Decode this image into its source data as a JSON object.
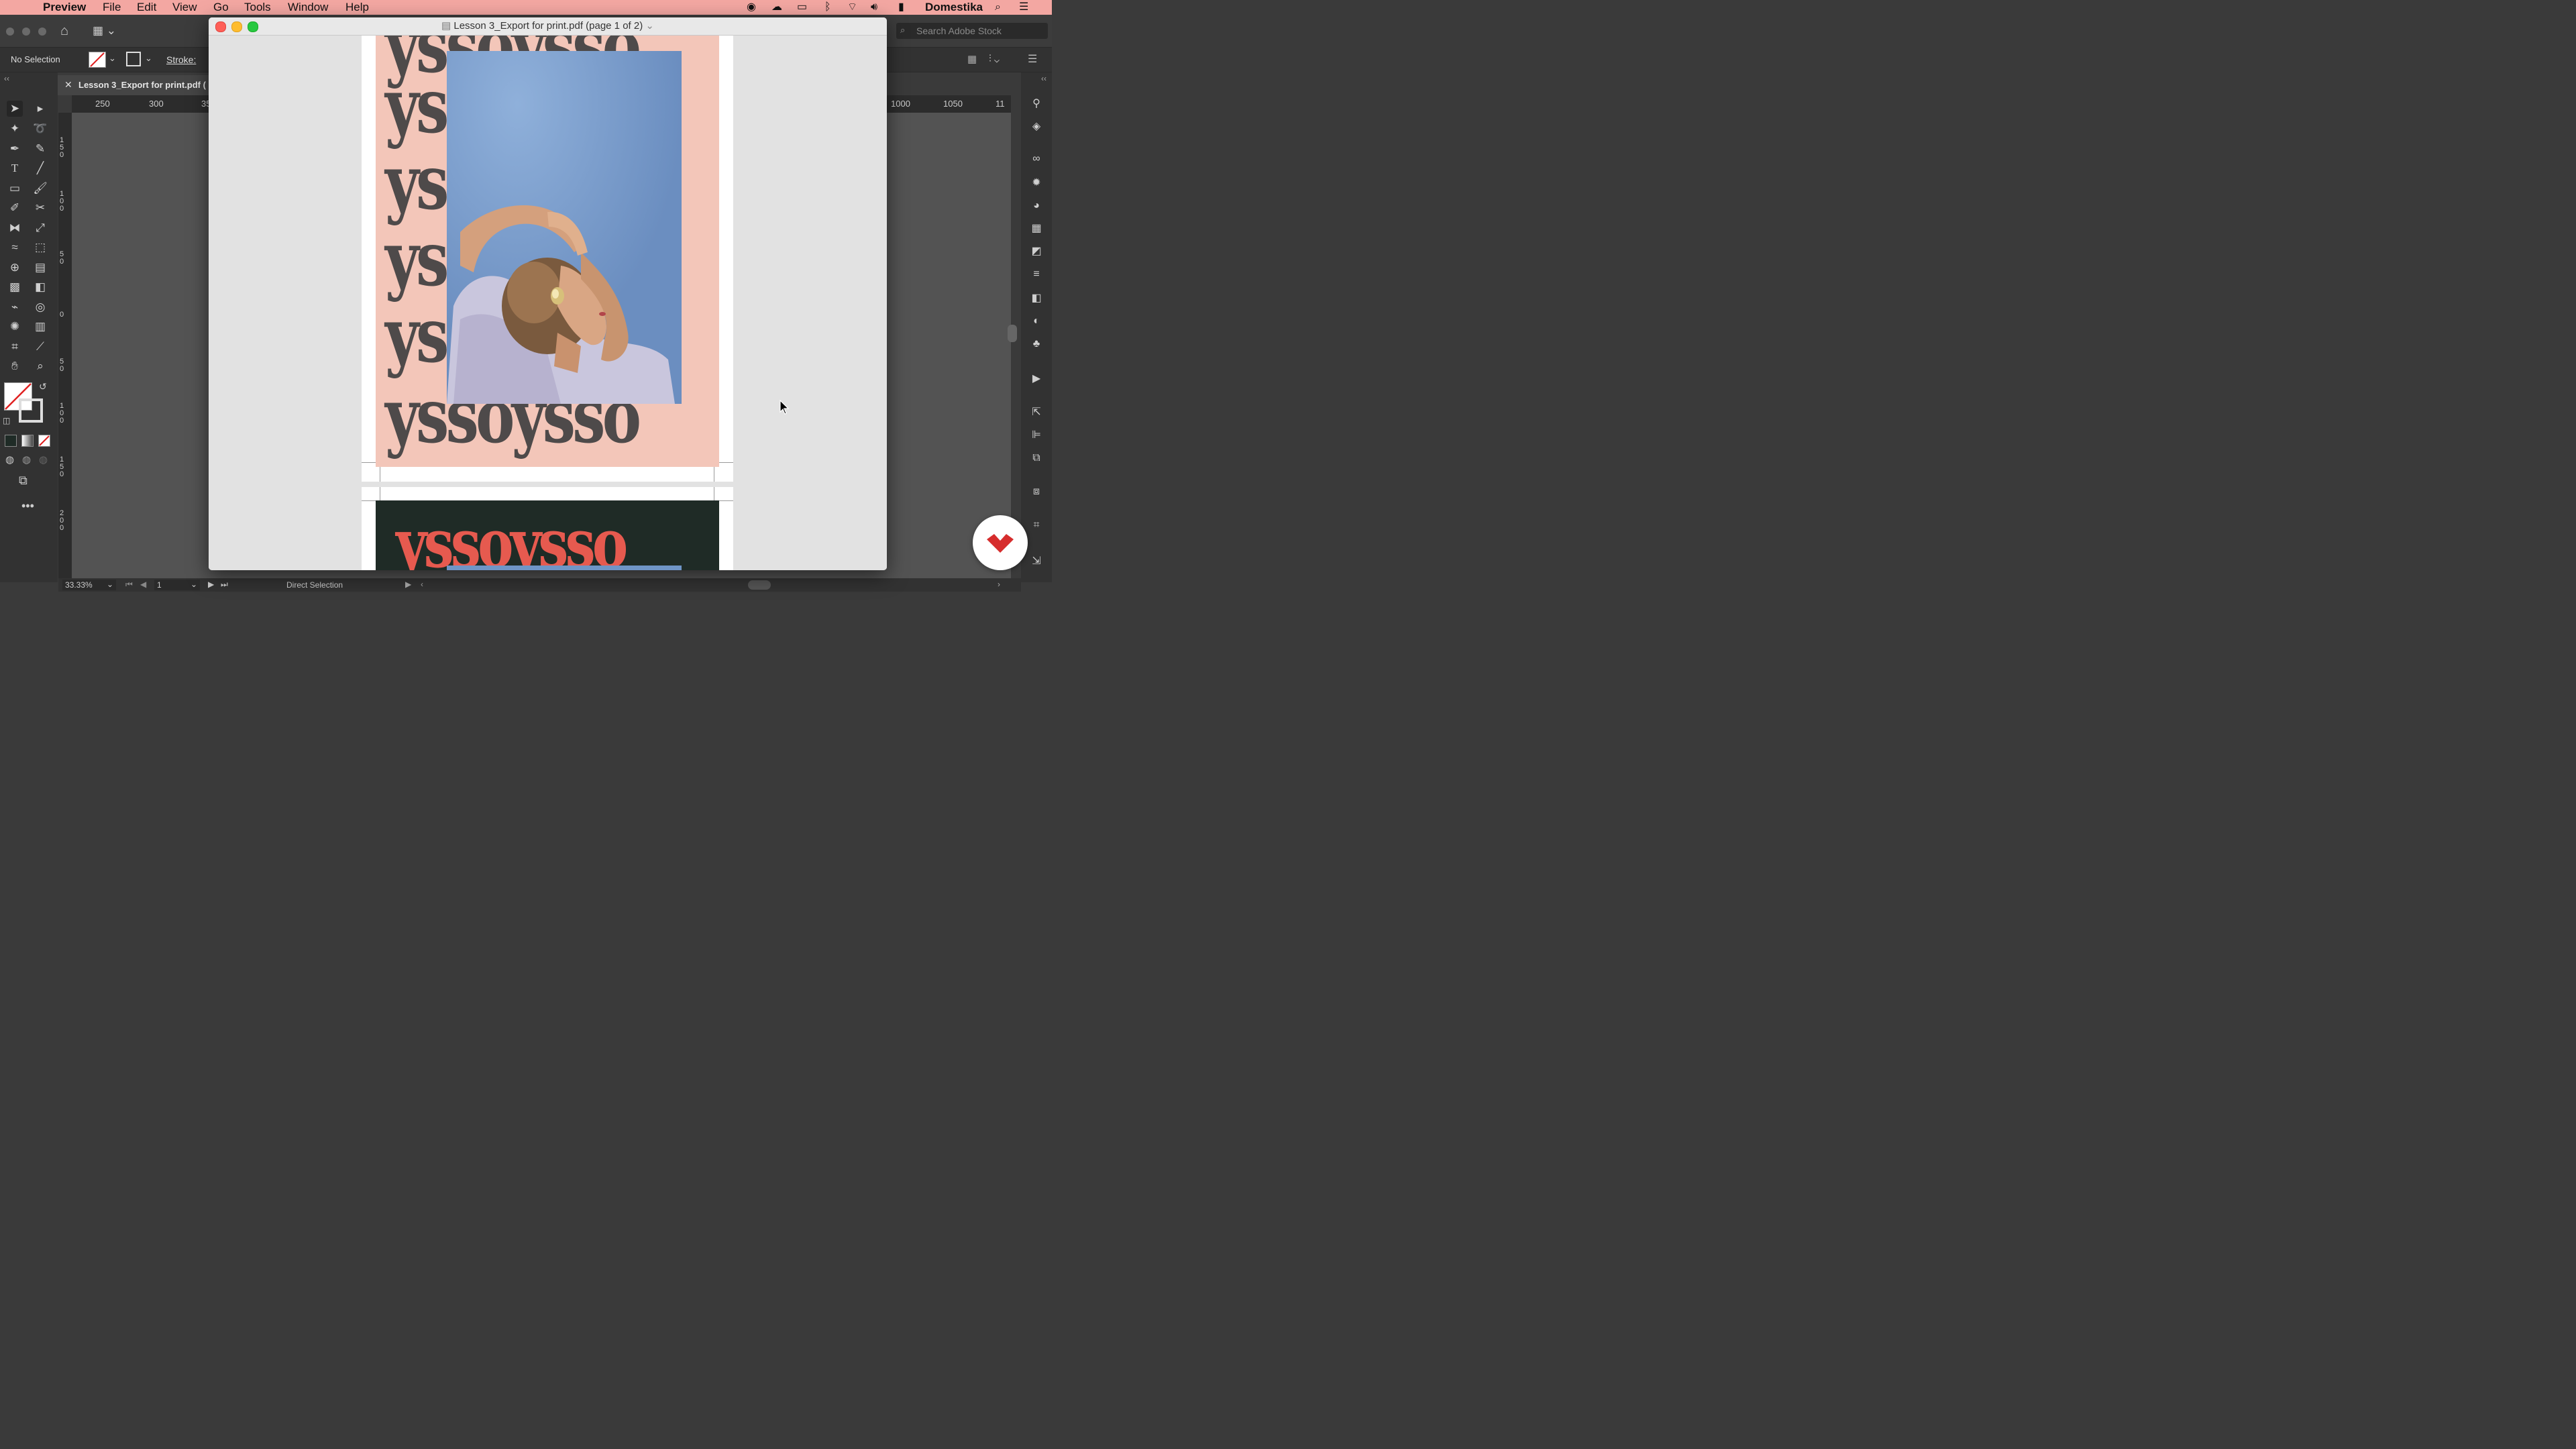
{
  "menubar": {
    "app": "Preview",
    "items": [
      "File",
      "Edit",
      "View",
      "Go",
      "Tools",
      "Window",
      "Help"
    ],
    "user": "Domestika"
  },
  "illustrator": {
    "search_placeholder": "Search Adobe Stock",
    "selection_label": "No Selection",
    "stroke_label": "Stroke:",
    "doc_tab": "Lesson 3_Export for print.pdf (",
    "ruler_h_left": [
      "250",
      "300",
      "35"
    ],
    "ruler_h_right": [
      "1000",
      "1050",
      "11"
    ],
    "ruler_v": [
      "150",
      "100",
      "50",
      "0",
      "50",
      "100",
      "150",
      "200"
    ],
    "zoom": "33.33%",
    "artboard": "1",
    "status_tool": "Direct Selection"
  },
  "preview": {
    "title": "Lesson 3_Export for print.pdf (page 1 of 2)",
    "page1_word": "ysso",
    "page2_word": "ysso"
  },
  "colors": {
    "menubar_bg": "#f3a7a2",
    "poster1_bg": "#f3c6b9",
    "poster1_type": "#4e4a4a",
    "poster2_bg": "#1f2b26",
    "poster2_type": "#e65a4f",
    "sky": "#7aa0cf",
    "domestika_red": "#d62d2d"
  }
}
